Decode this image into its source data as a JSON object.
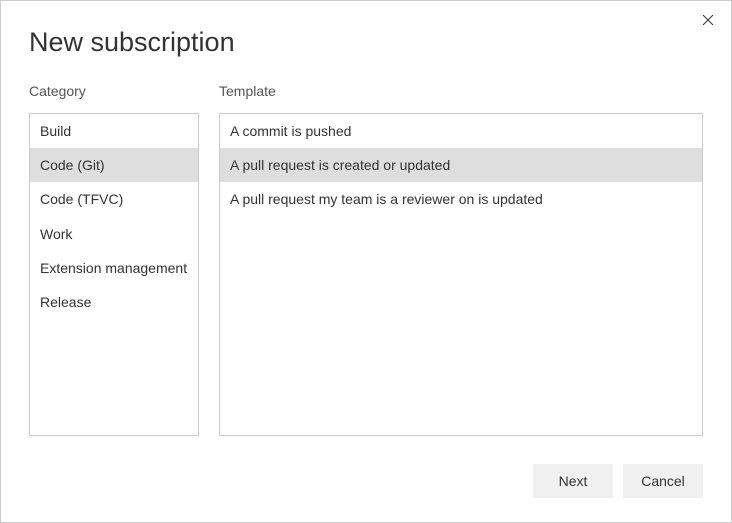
{
  "dialog": {
    "title": "New subscription"
  },
  "labels": {
    "category": "Category",
    "template": "Template"
  },
  "categories": {
    "items": [
      {
        "label": "Build",
        "selected": false
      },
      {
        "label": "Code (Git)",
        "selected": true
      },
      {
        "label": "Code (TFVC)",
        "selected": false
      },
      {
        "label": "Work",
        "selected": false
      },
      {
        "label": "Extension management",
        "selected": false
      },
      {
        "label": "Release",
        "selected": false
      }
    ]
  },
  "templates": {
    "items": [
      {
        "label": "A commit is pushed",
        "selected": false
      },
      {
        "label": "A pull request is created or updated",
        "selected": true
      },
      {
        "label": "A pull request my team is a reviewer on is updated",
        "selected": false
      }
    ]
  },
  "footer": {
    "next_label": "Next",
    "cancel_label": "Cancel"
  }
}
